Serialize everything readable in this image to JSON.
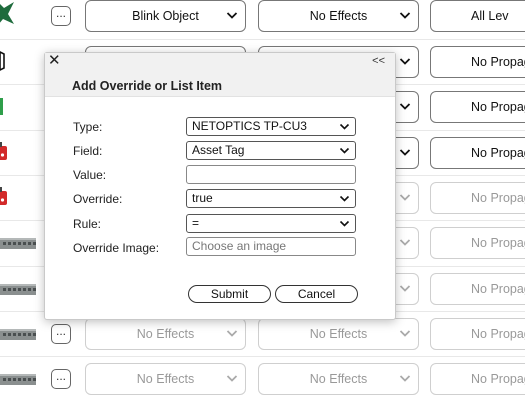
{
  "background_rows": [
    {
      "thumb": "star-icon",
      "col1": "Blink Object",
      "col2": "No Effects",
      "col3": "All Lev",
      "disabled": false
    },
    {
      "thumb": "outline-object-icon",
      "col1": "",
      "col2": "",
      "col3": "No Propag",
      "disabled": false
    },
    {
      "thumb": "green-bar-icon",
      "col1": "",
      "col2": "",
      "col3": "No Propag",
      "disabled": false
    },
    {
      "thumb": "device-red-icon",
      "col1": "",
      "col2": "",
      "col3": "No Propag",
      "disabled": false
    },
    {
      "thumb": "device-red-icon",
      "col1": "",
      "col2": "",
      "col3": "No Propag",
      "disabled": true
    },
    {
      "thumb": "network-switch-icon",
      "col1": "",
      "col2": "",
      "col3": "No Propag",
      "disabled": true
    },
    {
      "thumb": "network-switch-icon",
      "col1": "",
      "col2": "",
      "col3": "No Propag",
      "disabled": true
    },
    {
      "thumb": "network-switch-icon",
      "col1": "No Effects",
      "col2": "No Effects",
      "col3": "No Propag",
      "disabled": true
    },
    {
      "thumb": "network-switch-icon",
      "col1": "No Effects",
      "col2": "No Effects",
      "col3": "No Propag",
      "disabled": true
    }
  ],
  "row_menu_glyph": "...",
  "dialog": {
    "close_glyph": "✕",
    "collapse_glyph": "<<",
    "title": "Add Override or List Item",
    "type_label": "Type:",
    "type_value": "NETOPTICS TP-CU3",
    "field_label": "Field:",
    "field_value": "Asset Tag",
    "value_label": "Value:",
    "value_value": "",
    "override_label": "Override:",
    "override_value": "true",
    "rule_label": "Rule:",
    "rule_value": "=",
    "override_image_label": "Override Image:",
    "override_image_placeholder": "Choose an image",
    "submit_label": "Submit",
    "cancel_label": "Cancel"
  },
  "colors": {
    "accent_green": "#1e6b3c",
    "red_device": "#d22a2a",
    "switch_gray": "#8a8f8f"
  }
}
